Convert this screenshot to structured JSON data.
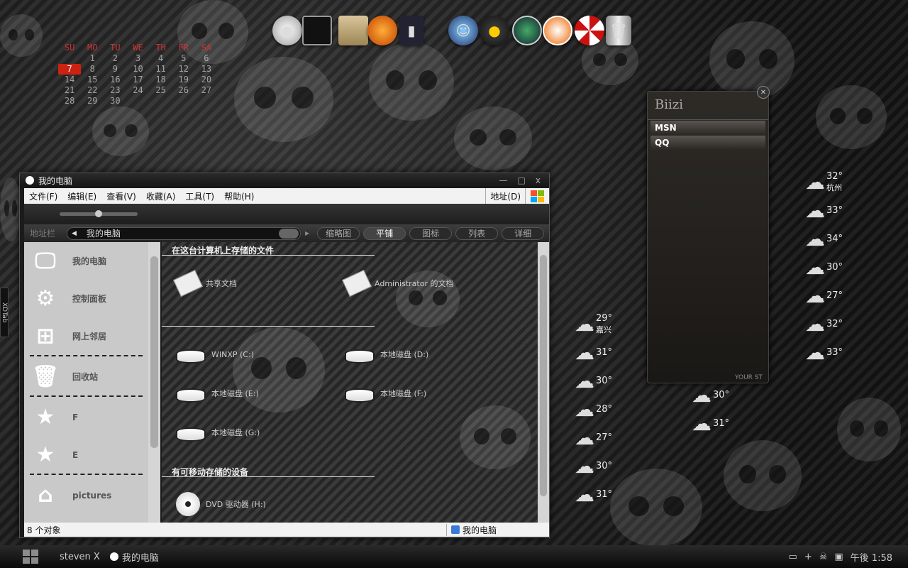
{
  "calendar": {
    "header": [
      "SU",
      "MO",
      "TU",
      "WE",
      "TH",
      "FR",
      "SA"
    ],
    "weeks": [
      [
        "",
        "",
        "1",
        "2",
        "3",
        "4",
        "5",
        "6"
      ],
      [
        "7",
        "8",
        "9",
        "10",
        "11",
        "12",
        "13"
      ],
      [
        "14",
        "15",
        "16",
        "17",
        "18",
        "19",
        "20"
      ],
      [
        "21",
        "22",
        "23",
        "24",
        "25",
        "26",
        "27"
      ],
      [
        "28",
        "29",
        "30",
        "",
        "",
        "",
        ""
      ]
    ],
    "today": "7"
  },
  "dock": {
    "icons": [
      "orb-icon",
      "monitor-icon",
      "folder-icon",
      "media-player-icon",
      "book-icon",
      "messenger-icon",
      "qq-penguin-icon",
      "network-icon",
      "frame-icon",
      "umbrella-icon",
      "trash-icon"
    ]
  },
  "explorer": {
    "title": "我的电脑",
    "menu": [
      "文件(F)",
      "编辑(E)",
      "查看(V)",
      "收藏(A)",
      "工具(T)",
      "帮助(H)"
    ],
    "address_label": "地址(D)",
    "nav": {
      "label": "地址栏",
      "path": "我的电脑",
      "views": [
        "缩略图",
        "平铺",
        "图标",
        "列表",
        "详细"
      ],
      "active_view": "平铺"
    },
    "sidebar": [
      {
        "icon": "monitor-icon",
        "label": "我的电脑"
      },
      {
        "icon": "gear-icon",
        "label": "控制面板"
      },
      {
        "icon": "network-icon",
        "label": "网上邻居"
      },
      {
        "icon": "recycle-bin-icon",
        "label": "回收站"
      },
      {
        "icon": "star-icon",
        "label": "F"
      },
      {
        "icon": "star-icon",
        "label": "E"
      },
      {
        "icon": "home-icon",
        "label": "pictures"
      }
    ],
    "sections": {
      "files": "在这台计算机上存储的文件",
      "devices": "有可移动存储的设备"
    },
    "items": {
      "shared": "共享文档",
      "admin": "Administrator 的文档",
      "c": "WINXP (C:)",
      "d": "本地磁盘 (D:)",
      "e": "本地磁盘 (E:)",
      "f": "本地磁盘 (F:)",
      "g": "本地磁盘 (G:)",
      "dvd": "DVD 驱动器 (H:)"
    },
    "status": {
      "count": "8 个对象",
      "location": "我的电脑"
    }
  },
  "biizi": {
    "title": "Biizi",
    "contacts": [
      "MSN",
      "QQ"
    ],
    "footer": "YOUR ST"
  },
  "weather": {
    "right": [
      {
        "temp": "32°",
        "city": "杭州"
      },
      {
        "temp": "33°"
      },
      {
        "temp": "34°"
      },
      {
        "temp": "30°"
      },
      {
        "temp": "27°"
      },
      {
        "temp": "32°"
      },
      {
        "temp": "33°"
      }
    ],
    "middle": [
      {
        "temp": "29°",
        "city": "嘉兴"
      },
      {
        "temp": "31°"
      },
      {
        "temp": "30°"
      },
      {
        "temp": "28°"
      },
      {
        "temp": "27°"
      },
      {
        "temp": "30°"
      },
      {
        "temp": "31°"
      }
    ],
    "inner": [
      {
        "temp": "30°"
      },
      {
        "temp": "31°"
      }
    ]
  },
  "taskbar": {
    "user": "steven X",
    "task": "我的电脑",
    "clock": "午後 1:58"
  },
  "side_tab": "XDTab",
  "colors": {
    "accent_red": "#cc2211",
    "menu_bg": "#f2f2f2",
    "sidebar_bg": "#c9c9c9"
  }
}
